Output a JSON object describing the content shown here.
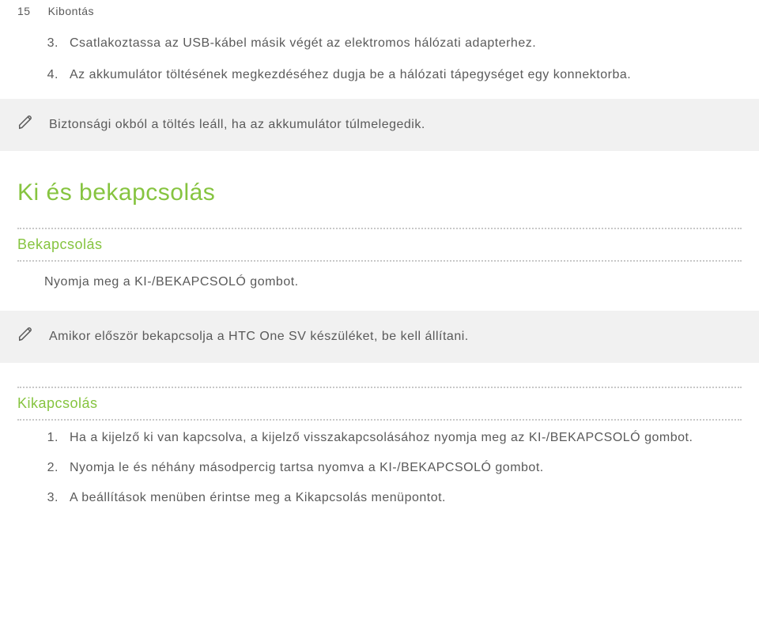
{
  "header": {
    "page_number": "15",
    "section_title": "Kibontás"
  },
  "list1": {
    "items": [
      {
        "num": "3.",
        "text": "Csatlakoztassa az USB-kábel másik végét az elektromos hálózati adapterhez."
      },
      {
        "num": "4.",
        "text": "Az akkumulátor töltésének megkezdéséhez dugja be a hálózati tápegységet egy konnektorba."
      }
    ]
  },
  "note1": {
    "text": "Biztonsági okból a töltés leáll, ha az akkumulátor túlmelegedik."
  },
  "heading2": "Ki és bekapcsolás",
  "sub1": {
    "title": "Bekapcsolás",
    "body": "Nyomja meg a KI-/BEKAPCSOLÓ gombot."
  },
  "note2": {
    "text": "Amikor először bekapcsolja a HTC One SV készüléket, be kell állítani."
  },
  "sub2": {
    "title": "Kikapcsolás",
    "items": [
      {
        "num": "1.",
        "text": "Ha a kijelző ki van kapcsolva, a kijelző visszakapcsolásához nyomja meg az KI-/BEKAPCSOLÓ gombot."
      },
      {
        "num": "2.",
        "text": "Nyomja le és néhány másodpercig tartsa nyomva a KI-/BEKAPCSOLÓ gombot."
      },
      {
        "num": "3.",
        "text": "A beállítások menüben érintse meg a Kikapcsolás menüpontot."
      }
    ]
  }
}
